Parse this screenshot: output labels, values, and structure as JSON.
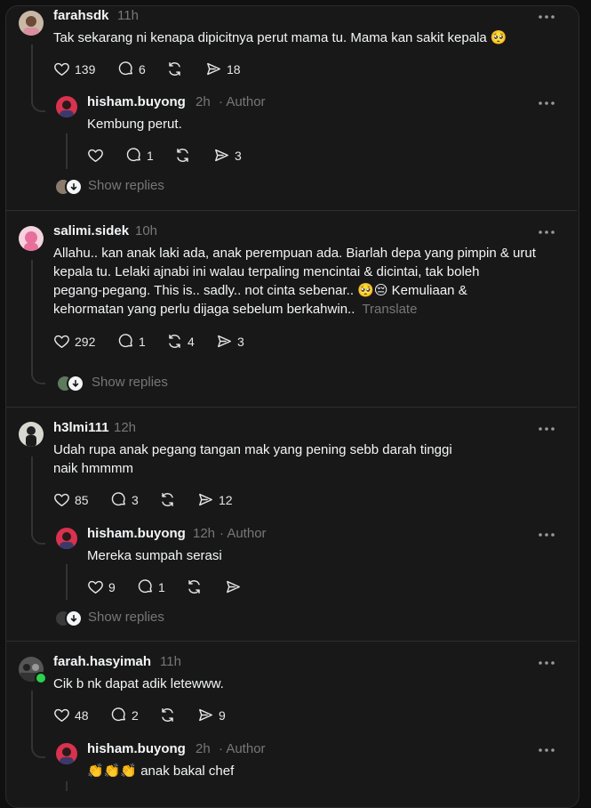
{
  "comments": [
    {
      "user": "farahsdk",
      "time": "11h",
      "text": "Tak sekarang ni kenapa dipicitnya perut mama tu. Mama kan sakit kepala 🥺",
      "likes": "139",
      "replies": "6",
      "reposts": "",
      "shares": "18",
      "reply": {
        "user": "hisham.buyong",
        "time": "2h",
        "author": "· Author",
        "text": "Kembung perut.",
        "likes": "",
        "replies": "1",
        "reposts": "",
        "shares": "3"
      },
      "show_replies": "Show replies"
    },
    {
      "user": "salimi.sidek",
      "time": "10h",
      "text_lines": [
        "Allahu.. kan anak laki ada, anak perempuan ada. Biarlah depa yang pimpin & urut",
        "kepala tu. Lelaki ajnabi ini walau terpaling mencintai & dicintai, tak boleh",
        "pegang-pegang. This is.. sadly.. not cinta sebenar.. 🥺😔 Kemuliaan &",
        "kehormatan yang perlu dijaga sebelum berkahwin.."
      ],
      "translate": "Translate",
      "likes": "292",
      "replies": "1",
      "reposts": "4",
      "shares": "3",
      "show_replies": "Show replies"
    },
    {
      "user": "h3lmi111",
      "time": "12h",
      "text_lines": [
        "Udah rupa anak pegang tangan mak yang pening sebb darah tinggi",
        "naik hmmmm"
      ],
      "likes": "85",
      "replies": "3",
      "reposts": "",
      "shares": "12",
      "reply": {
        "user": "hisham.buyong",
        "time": "12h",
        "author": "· Author",
        "text": "Mereka sumpah serasi",
        "likes": "9",
        "replies": "1",
        "reposts": "",
        "shares": ""
      },
      "show_replies": "Show replies"
    },
    {
      "user": "farah.hasyimah",
      "time": "11h",
      "text": "Cik b nk dapat adik letewww.",
      "likes": "48",
      "replies": "2",
      "reposts": "",
      "shares": "9",
      "reply": {
        "user": "hisham.buyong",
        "time": "2h",
        "author": "· Author",
        "text": "👏👏👏 anak bakal chef"
      }
    }
  ]
}
